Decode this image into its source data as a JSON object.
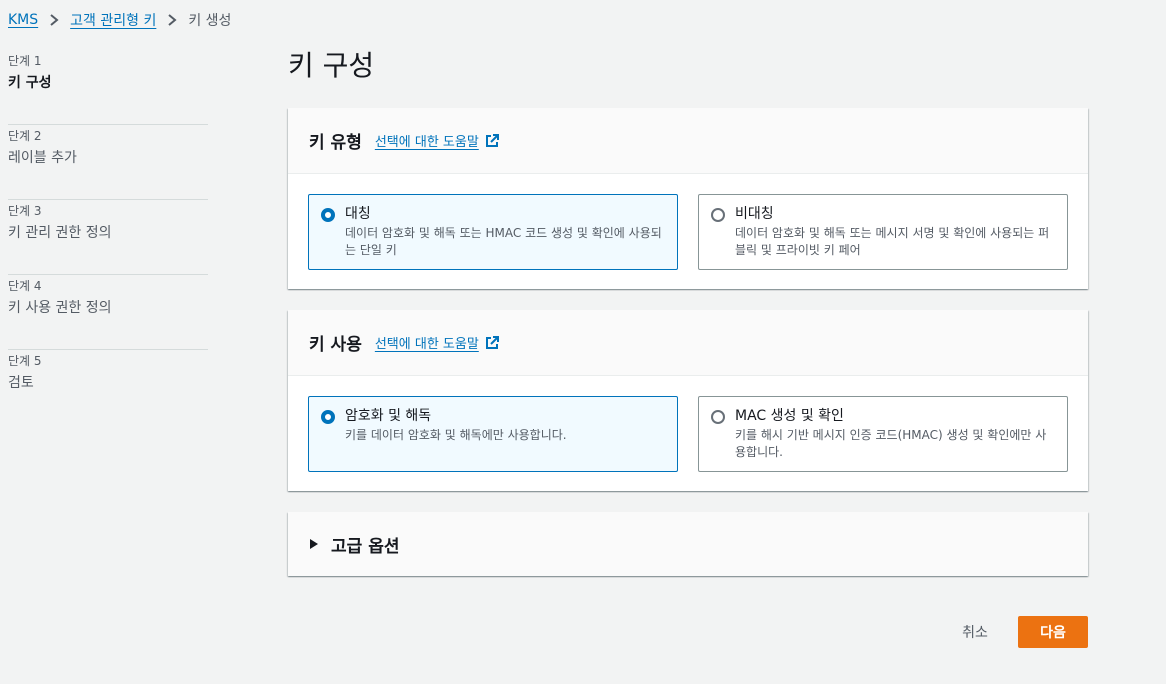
{
  "breadcrumb": {
    "items": [
      {
        "label": "KMS"
      },
      {
        "label": "고객 관리형 키"
      }
    ],
    "current": "키 생성"
  },
  "steps": [
    {
      "num": "단계 1",
      "label": "키 구성"
    },
    {
      "num": "단계 2",
      "label": "레이블 추가"
    },
    {
      "num": "단계 3",
      "label": "키 관리 권한 정의"
    },
    {
      "num": "단계 4",
      "label": "키 사용 권한 정의"
    },
    {
      "num": "단계 5",
      "label": "검토"
    }
  ],
  "page_title": "키 구성",
  "key_type": {
    "title": "키 유형",
    "help_link": "선택에 대한 도움말",
    "options": [
      {
        "title": "대칭",
        "desc": "데이터 암호화 및 해독 또는 HMAC 코드 생성 및 확인에 사용되는 단일 키"
      },
      {
        "title": "비대칭",
        "desc": "데이터 암호화 및 해독 또는 메시지 서명 및 확인에 사용되는 퍼블릭 및 프라이빗 키 페어"
      }
    ],
    "selected": "대칭"
  },
  "key_usage": {
    "title": "키 사용",
    "help_link": "선택에 대한 도움말",
    "options": [
      {
        "title": "암호화 및 해독",
        "desc": "키를 데이터 암호화 및 해독에만 사용합니다."
      },
      {
        "title": "MAC 생성 및 확인",
        "desc": "키를 해시 기반 메시지 인증 코드(HMAC) 생성 및 확인에만 사용합니다."
      }
    ],
    "selected": "암호화 및 해독"
  },
  "advanced": {
    "title": "고급 옵션"
  },
  "actions": {
    "cancel": "취소",
    "next": "다음"
  },
  "colors": {
    "accent": "#0073bb",
    "primary_button": "#ec7211",
    "background": "#f2f3f3"
  }
}
